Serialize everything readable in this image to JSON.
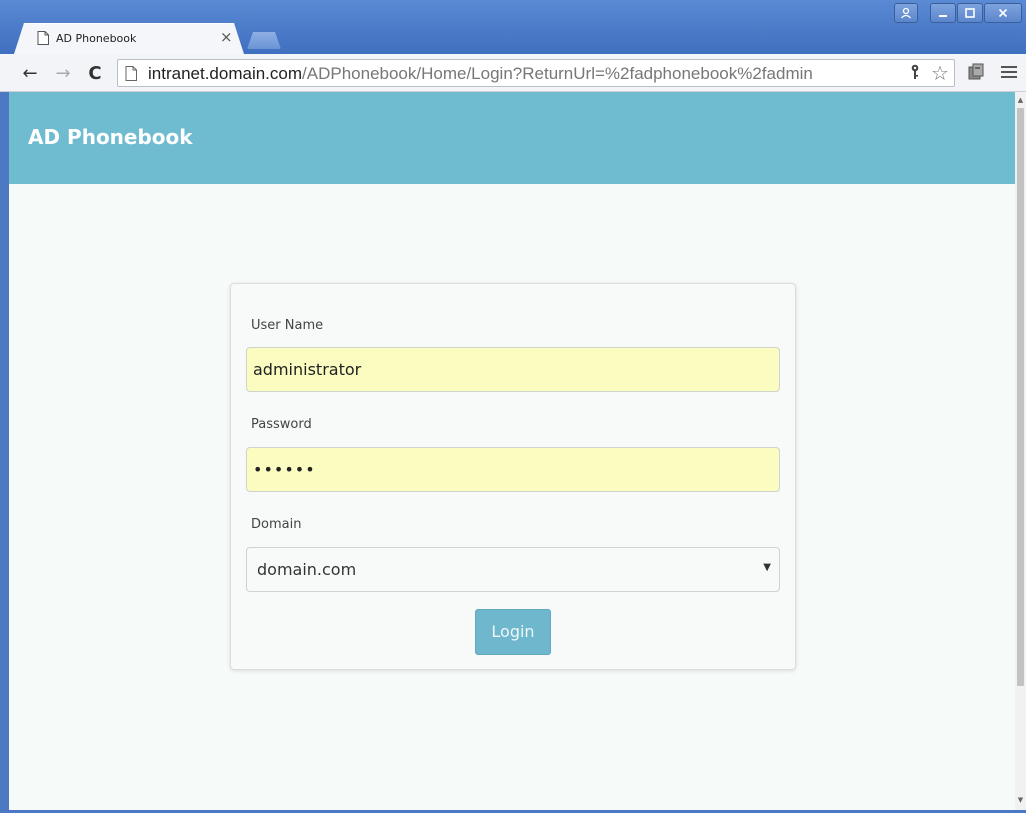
{
  "browser": {
    "tab": {
      "title": "AD Phonebook",
      "close_glyph": "×",
      "icon": "page-icon"
    },
    "window_controls": {
      "user": "user-icon",
      "minimize": "minimize-icon",
      "maximize": "maximize-icon",
      "close": "close-icon"
    },
    "toolbar": {
      "back": "←",
      "forward": "→",
      "reload": "C",
      "url_host": "intranet.domain.com",
      "url_path": "/ADPhonebook/Home/Login?ReturnUrl=%2fadphonebook%2fadmin",
      "key_glyph": "🔑",
      "star_glyph": "☆"
    }
  },
  "page": {
    "navbar": {
      "brand": "AD Phonebook"
    },
    "login_form": {
      "username_label": "User Name",
      "username_value": "administrator",
      "password_label": "Password",
      "password_value": "••••••",
      "domain_label": "Domain",
      "domain_selected": "domain.com",
      "login_button": "Login"
    },
    "colors": {
      "navbar_bg": "#6fbbd0",
      "autofill_bg": "#fafcc0",
      "button_bg": "#6fb7cd",
      "window_frame": "#4d79c4"
    }
  }
}
